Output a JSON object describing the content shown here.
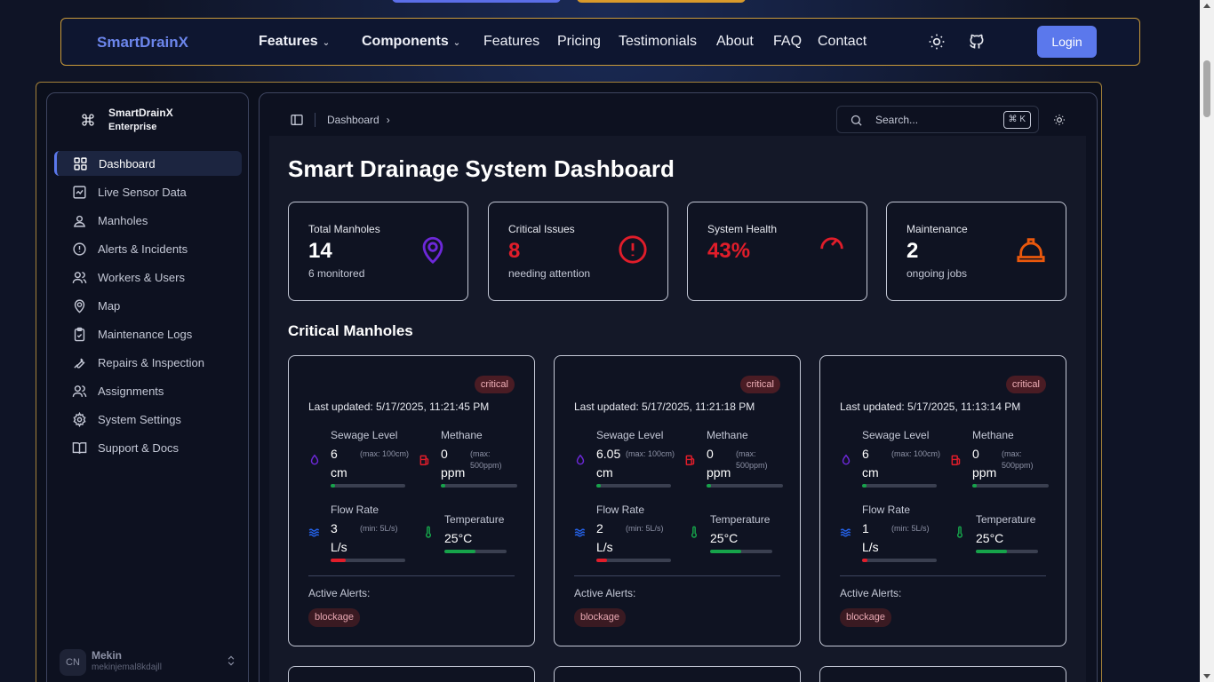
{
  "navbar": {
    "brand": "SmartDrainX",
    "items": [
      {
        "label": "Features",
        "dropdown": true
      },
      {
        "label": "Components",
        "dropdown": true
      },
      {
        "label": "Features"
      },
      {
        "label": "Pricing"
      },
      {
        "label": "Testimonials"
      },
      {
        "label": "About"
      },
      {
        "label": "FAQ"
      },
      {
        "label": "Contact"
      }
    ],
    "icons": [
      "sun-icon",
      "github-icon"
    ],
    "login_label": "Login"
  },
  "sidebar": {
    "title": "SmartDrainX",
    "subtitle": "Enterprise",
    "items": [
      {
        "label": "Dashboard",
        "icon": "grid-icon",
        "active": true
      },
      {
        "label": "Live Sensor Data",
        "icon": "activity-icon"
      },
      {
        "label": "Manholes",
        "icon": "person-pin-icon"
      },
      {
        "label": "Alerts & Incidents",
        "icon": "alert-circle-icon"
      },
      {
        "label": "Workers & Users",
        "icon": "users-icon"
      },
      {
        "label": "Map",
        "icon": "map-pin-icon"
      },
      {
        "label": "Maintenance Logs",
        "icon": "clipboard-check-icon"
      },
      {
        "label": "Repairs & Inspection",
        "icon": "wrench-icon"
      },
      {
        "label": "Assignments",
        "icon": "users-icon"
      },
      {
        "label": "System Settings",
        "icon": "gear-icon"
      },
      {
        "label": "Support & Docs",
        "icon": "book-icon"
      }
    ],
    "user": {
      "initials": "CN",
      "name": "Mekin",
      "email": "mekinjemal8kdajll"
    }
  },
  "topbar": {
    "breadcrumb": "Dashboard",
    "search_placeholder": "Search...",
    "shortcut": "⌘ K"
  },
  "page": {
    "title": "Smart Drainage System Dashboard",
    "section_title": "Critical Manholes"
  },
  "stats": [
    {
      "label": "Total Manholes",
      "value": "14",
      "sub": "6 monitored",
      "icon": "map-pin-icon",
      "color": "#6d28d9"
    },
    {
      "label": "Critical Issues",
      "value": "8",
      "sub": "needing attention",
      "icon": "alert-circle-icon",
      "color": "#e11d2a"
    },
    {
      "label": "System Health",
      "value": "43%",
      "sub": "",
      "icon": "gauge-icon",
      "color": "#e11d2a"
    },
    {
      "label": "Maintenance",
      "value": "2",
      "sub": "ongoing jobs",
      "icon": "hard-hat-icon",
      "color": "#ea580c"
    }
  ],
  "manholes": [
    {
      "status": "critical",
      "updated": "Last updated: 5/17/2025, 11:21:45 PM",
      "sewage": {
        "label": "Sewage Level",
        "value": "6",
        "unit": "cm",
        "hint": "(max: 100cm)",
        "level": 0.06
      },
      "methane": {
        "label": "Methane",
        "value": "0",
        "unit": "ppm",
        "hint": "(max: 500ppm)",
        "level": 0
      },
      "flow": {
        "label": "Flow Rate",
        "value": "3",
        "unit": "L/s",
        "hint": "(min: 5L/s)",
        "level": 0.2
      },
      "temperature": {
        "label": "Temperature",
        "value": "25°C",
        "level": 0.5
      },
      "alerts_label": "Active Alerts:",
      "alerts": [
        "blockage"
      ]
    },
    {
      "status": "critical",
      "updated": "Last updated: 5/17/2025, 11:21:18 PM",
      "sewage": {
        "label": "Sewage Level",
        "value": "6.05",
        "unit": "cm",
        "hint": "(max: 100cm)",
        "level": 0.06
      },
      "methane": {
        "label": "Methane",
        "value": "0",
        "unit": "ppm",
        "hint": "(max: 500ppm)",
        "level": 0
      },
      "flow": {
        "label": "Flow Rate",
        "value": "2",
        "unit": "L/s",
        "hint": "(min: 5L/s)",
        "level": 0.14
      },
      "temperature": {
        "label": "Temperature",
        "value": "25°C",
        "level": 0.5
      },
      "alerts_label": "Active Alerts:",
      "alerts": [
        "blockage"
      ]
    },
    {
      "status": "critical",
      "updated": "Last updated: 5/17/2025, 11:13:14 PM",
      "sewage": {
        "label": "Sewage Level",
        "value": "6",
        "unit": "cm",
        "hint": "(max: 100cm)",
        "level": 0.06
      },
      "methane": {
        "label": "Methane",
        "value": "0",
        "unit": "ppm",
        "hint": "(max: 500ppm)",
        "level": 0
      },
      "flow": {
        "label": "Flow Rate",
        "value": "1",
        "unit": "L/s",
        "hint": "(min: 5L/s)",
        "level": 0.07
      },
      "temperature": {
        "label": "Temperature",
        "value": "25°C",
        "level": 0.5
      },
      "alerts_label": "Active Alerts:",
      "alerts": [
        "blockage"
      ]
    }
  ],
  "colors": {
    "accent": "#5b78ec",
    "critical": "#e11d2a",
    "good": "#16a34a",
    "navbar_border": "#c99a3a"
  }
}
